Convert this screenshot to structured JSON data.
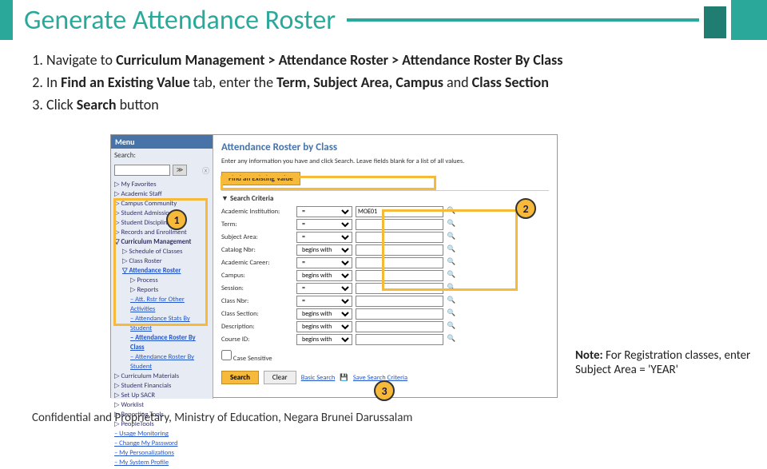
{
  "title": "Generate Attendance Roster",
  "steps": [
    {
      "n": "1.",
      "pre": "Navigate to ",
      "bold": "Curriculum Management > Attendance Roster > Attendance Roster By Class"
    },
    {
      "n": "2.",
      "pre": "In ",
      "bold": "Find an Existing Value",
      "post": " tab, enter the ",
      "bold2": "Term, Subject Area, Campus",
      "post2": " and ",
      "bold3": "Class Section"
    },
    {
      "n": "3.",
      "pre": "Click ",
      "bold": "Search",
      "post": " button"
    }
  ],
  "menu": {
    "header": "Menu",
    "search_placeholder": "Search:",
    "items": [
      "My Favorites",
      "Academic Staff",
      "Campus Community",
      "Student Admissions",
      "Student Discipline",
      "Records and Enrollment"
    ],
    "cm": "Curriculum Management",
    "cm_children": [
      "Schedule of Classes",
      "Class Roster"
    ],
    "ar": "Attendance Roster",
    "ar_children": [
      "Process",
      "Reports",
      "Att. Rstr for Other Activities",
      "Attendance Stats By Student",
      "Attendance Roster By Class",
      "Attendance Roster By Student"
    ],
    "rest": [
      "Curriculum Materials",
      "Student Financials",
      "Set Up SACR",
      "Worklist",
      "Reporting Tools",
      "PeopleTools",
      "Usage Monitoring",
      "Change My Password",
      "My Personalizations",
      "My System Profile"
    ]
  },
  "page": {
    "title": "Attendance Roster by Class",
    "sub": "Enter any information you have and click Search. Leave fields blank for a list of all values.",
    "tab": "Find an Existing Value",
    "sc": "▼ Search Criteria",
    "fields": [
      {
        "label": "Academic Institution:",
        "op": "=",
        "val": "MOE01"
      },
      {
        "label": "Term:",
        "op": "=",
        "val": ""
      },
      {
        "label": "Subject Area:",
        "op": "=",
        "val": ""
      },
      {
        "label": "Catalog Nbr:",
        "op": "begins with",
        "val": ""
      },
      {
        "label": "Academic Career:",
        "op": "=",
        "val": ""
      },
      {
        "label": "Campus:",
        "op": "begins with",
        "val": ""
      },
      {
        "label": "Session:",
        "op": "=",
        "val": ""
      },
      {
        "label": "Class Nbr:",
        "op": "=",
        "val": ""
      },
      {
        "label": "Class Section:",
        "op": "begins with",
        "val": ""
      },
      {
        "label": "Description:",
        "op": "begins with",
        "val": ""
      },
      {
        "label": "Course ID:",
        "op": "begins with",
        "val": ""
      }
    ],
    "case": "Case Sensitive",
    "search": "Search",
    "clear": "Clear",
    "basic": "Basic Search",
    "save": "Save Search Criteria"
  },
  "markers": {
    "m1": "1",
    "m2": "2",
    "m3": "3"
  },
  "note": {
    "pre": "Note:",
    "body": " For Registration classes, enter Subject Area = 'YEAR'"
  },
  "footer": "Confidential and Proprietary, Ministry of Education, Negara Brunei Darussalam"
}
